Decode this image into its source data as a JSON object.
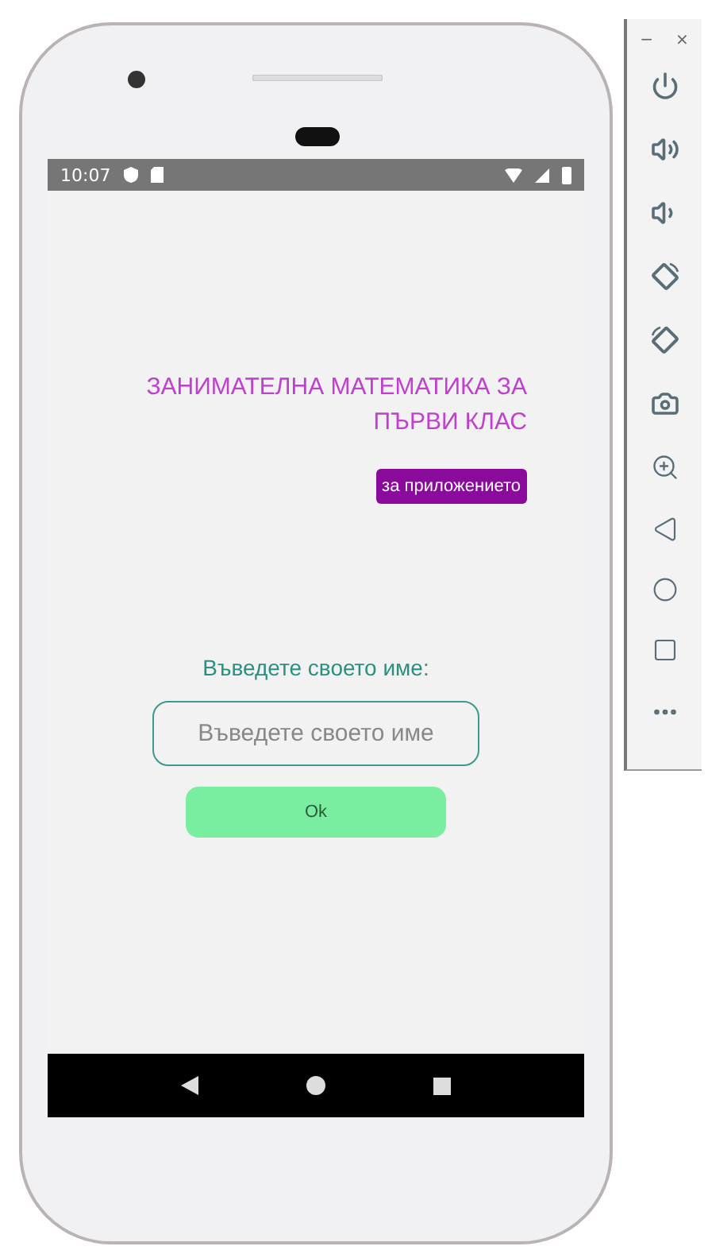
{
  "status_bar": {
    "time": "10:07"
  },
  "app": {
    "title": "ЗАНИМАТЕЛНА МАТЕМАТИКА ЗА ПЪРВИ КЛАС",
    "about_button": "за приложението",
    "name_label": "Въведете своето име:",
    "name_field": {
      "placeholder": "Въведете своето име"
    },
    "ok_button": "Ok"
  },
  "emulator_panel": {
    "window_controls": [
      "−",
      "×"
    ]
  }
}
